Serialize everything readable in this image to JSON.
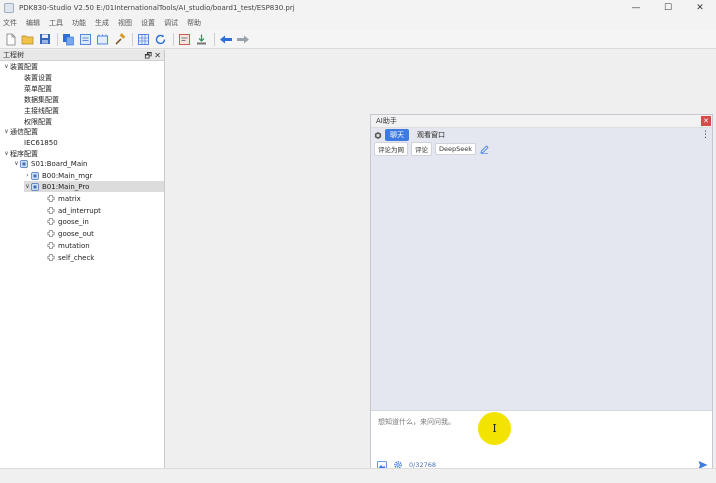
{
  "window": {
    "title": "PDK830-Studio V2.50 E:/01InternationalTools/AI_studio/board1_test/ESP830.prj",
    "minimize": "—",
    "maximize": "☐",
    "close": "✕"
  },
  "menu": [
    "文件",
    "编辑",
    "工具",
    "功能",
    "生成",
    "视图",
    "设置",
    "调试",
    "帮助"
  ],
  "toolbar": {
    "icons": [
      "new-file-icon",
      "open-folder-icon",
      "save-icon",
      "copy-icon",
      "config-icon",
      "build-icon",
      "hammer-icon",
      "grid-icon",
      "refresh-icon",
      "check-icon",
      "download-icon",
      "back-arrow-icon",
      "forward-arrow-icon"
    ],
    "accent": "#2d6fd6"
  },
  "tree": {
    "title": "工程树",
    "float_btn": "🗗",
    "close_btn": "✕",
    "nodes": [
      {
        "label": "装置配置",
        "chev": "∨",
        "icon": ""
      },
      {
        "label": "装置设置",
        "chev": "",
        "icon": ""
      },
      {
        "label": "菜单配置",
        "chev": "",
        "icon": ""
      },
      {
        "label": "数据集配置",
        "chev": "",
        "icon": ""
      },
      {
        "label": "主接线配置",
        "chev": "",
        "icon": ""
      },
      {
        "label": "权限配置",
        "chev": "",
        "icon": ""
      },
      {
        "label": "通信配置",
        "chev": "∨",
        "icon": ""
      },
      {
        "label": "IEC61850",
        "chev": "",
        "icon": ""
      },
      {
        "label": "程序配置",
        "chev": "∨",
        "icon": ""
      },
      {
        "label": "S01:Board_Main",
        "chev": "∨",
        "icon": "board"
      },
      {
        "label": "B00:Main_mgr",
        "chev": "›",
        "icon": "board"
      },
      {
        "label": "B01:Main_Pro",
        "chev": "∨",
        "icon": "board"
      },
      {
        "label": "matrix",
        "chev": "",
        "icon": "module"
      },
      {
        "label": "ad_interrupt",
        "chev": "",
        "icon": "module"
      },
      {
        "label": "goose_in",
        "chev": "",
        "icon": "module"
      },
      {
        "label": "goose_out",
        "chev": "",
        "icon": "module"
      },
      {
        "label": "mutation",
        "chev": "",
        "icon": "module"
      },
      {
        "label": "self_check",
        "chev": "",
        "icon": "module"
      }
    ]
  },
  "ai": {
    "title": "AI助手",
    "close": "✕",
    "tabs": [
      {
        "label": "聊天",
        "active": true
      },
      {
        "label": "观看窗口",
        "active": false
      }
    ],
    "menu": "⋮",
    "chips": [
      "评论为网",
      "评论",
      "DeepSeek"
    ],
    "input_placeholder": "想知道什么，来问问我。",
    "char_count": "0/32768"
  }
}
